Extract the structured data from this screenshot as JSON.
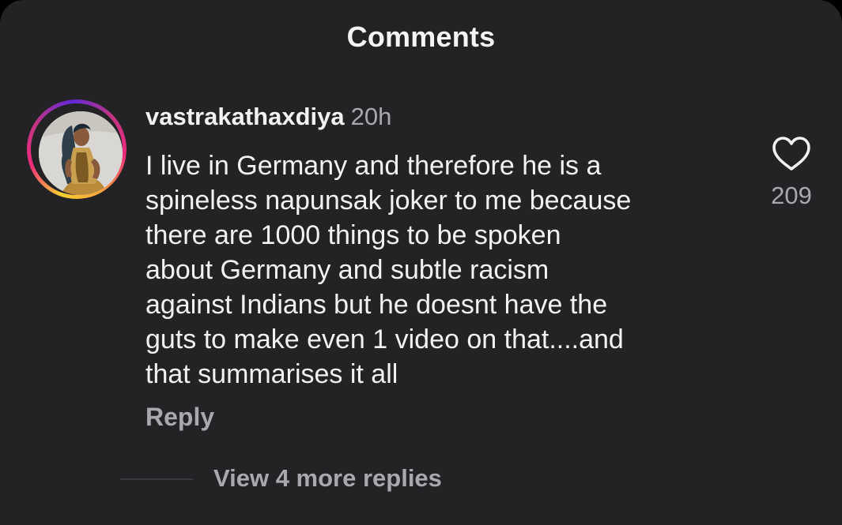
{
  "header": {
    "title": "Comments"
  },
  "comment": {
    "avatar_icon": "user-avatar",
    "username": "vastrakathaxdiya",
    "time": "20h",
    "lines": [
      "I live in Germany and therefore he is a",
      "spineless napunsak joker to me because",
      "there are 1000 things to be spoken",
      "about Germany and subtle racism",
      "against Indians but he doesnt have the",
      "guts to make even 1 video on that....and",
      "that summarises it all"
    ],
    "reply_label": "Reply",
    "like_icon": "heart-outline-icon",
    "like_count": "209",
    "view_replies_label": "View 4 more replies"
  },
  "colors": {
    "background": "#232326",
    "primary_text": "#f2f2f2",
    "secondary_text": "#a8a8ad",
    "story_ring": [
      "#f9ce34",
      "#ee2a7b",
      "#6228d7"
    ]
  }
}
